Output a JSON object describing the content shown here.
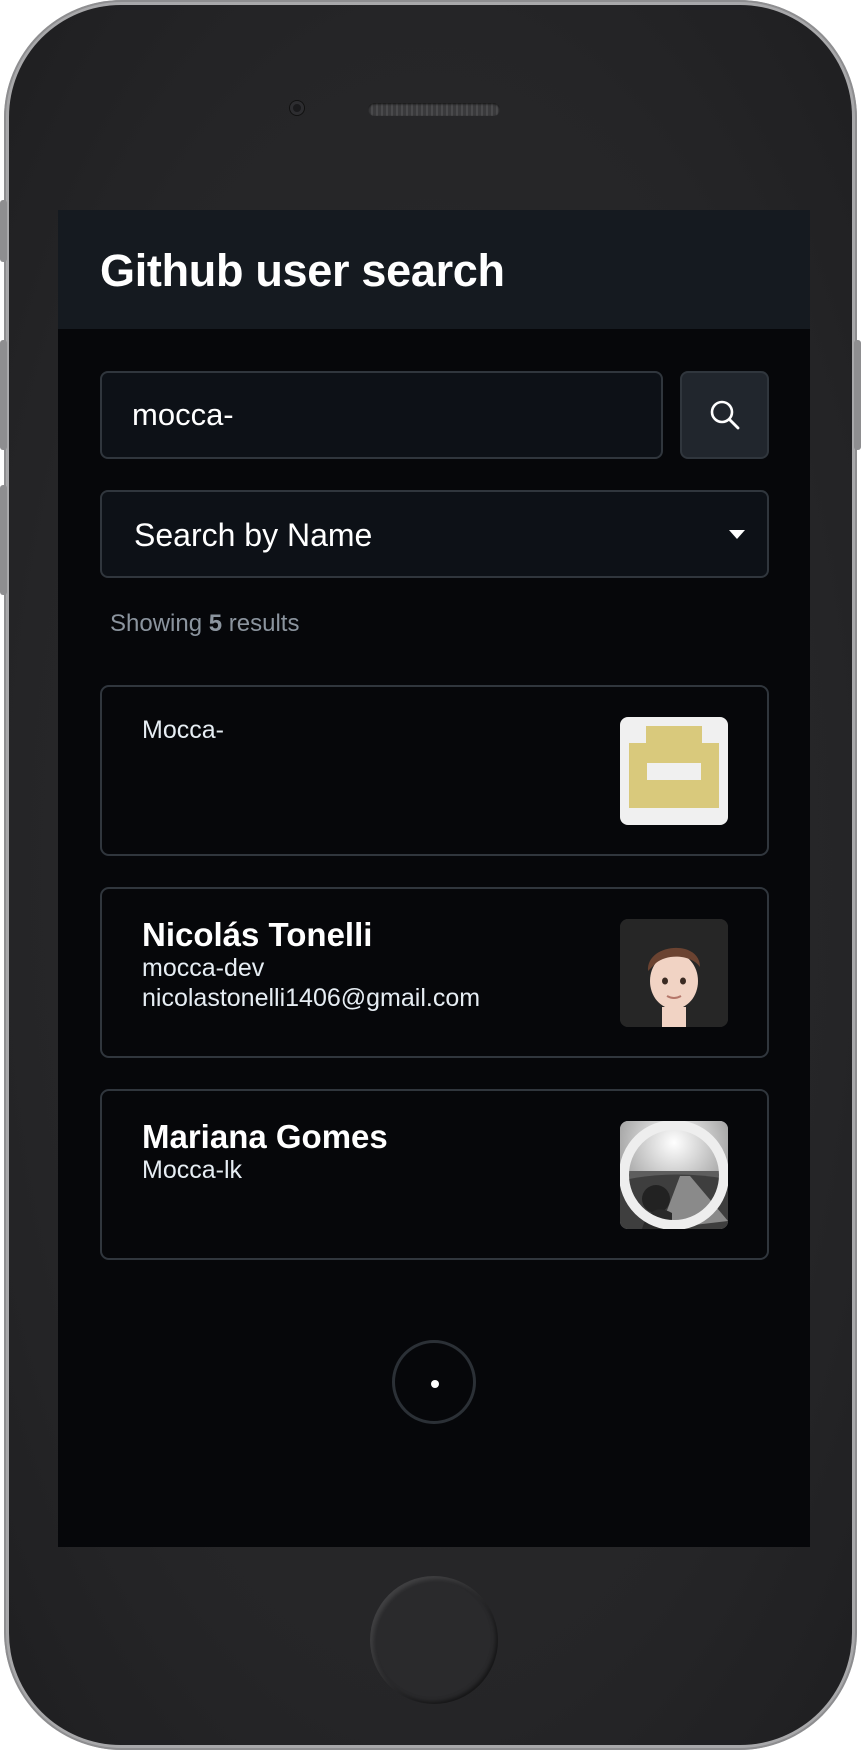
{
  "app": {
    "title": "Github user search"
  },
  "search": {
    "query": "mocca-",
    "button_icon": "search-icon"
  },
  "filter": {
    "selected": "Search by Name",
    "caret_icon": "caret-down-icon"
  },
  "results": {
    "prefix": "Showing",
    "count": "5",
    "suffix": "results"
  },
  "users": [
    {
      "name": "",
      "login": "",
      "email": "",
      "plain_label": "Mocca-",
      "avatar": "identicon-avatar"
    },
    {
      "name": "Nicolás Tonelli",
      "login": "mocca-dev",
      "email": "nicolastonelli1406@gmail.com",
      "avatar": "memoji-avatar"
    },
    {
      "name": "Mariana Gomes",
      "login": "Mocca-lk",
      "email": "",
      "avatar": "photo-avatar"
    }
  ],
  "colors": {
    "background": "#06070a",
    "header": "#151a20",
    "border": "#30363d",
    "muted_text": "#8b949e",
    "identicon": "#d9c97c"
  },
  "loading": true
}
